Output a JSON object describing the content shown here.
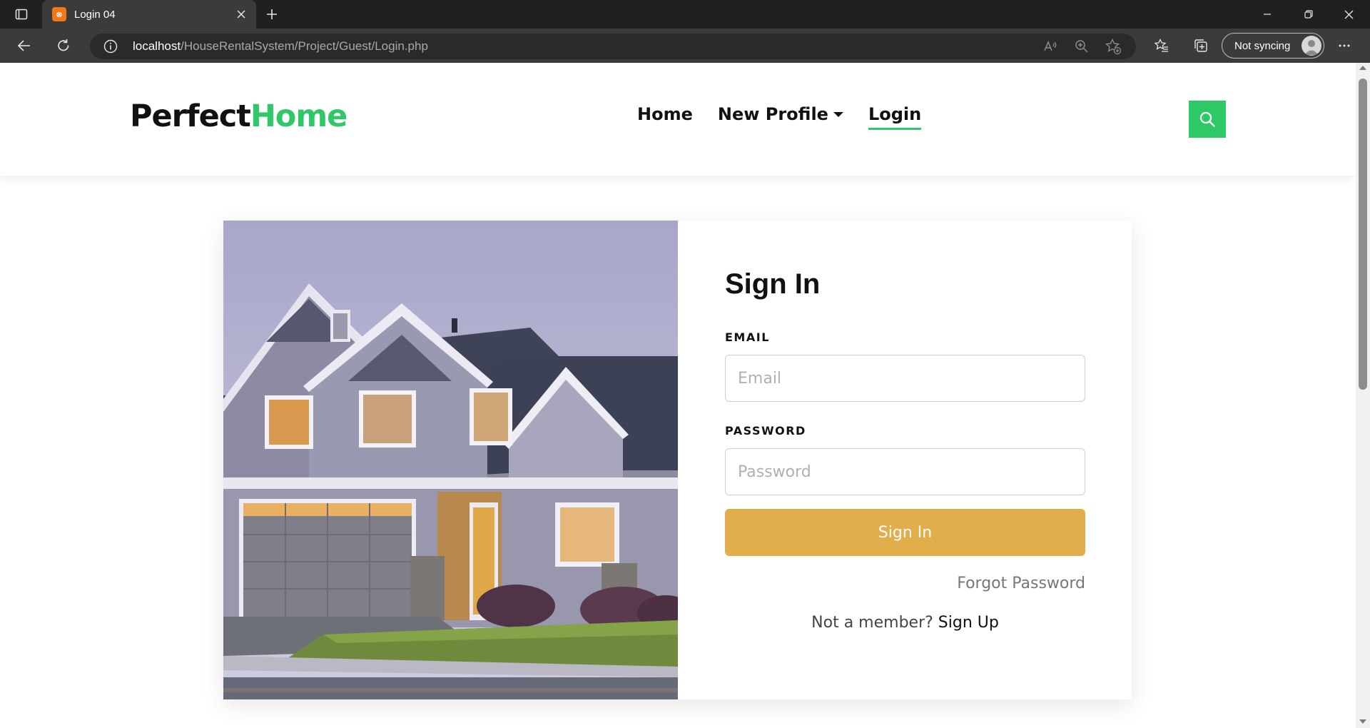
{
  "browser": {
    "tab_title": "Login 04",
    "favicon_text": "⊗",
    "url_host": "localhost",
    "url_path": "/HouseRentalSystem/Project/Guest/Login.php",
    "sync_label": "Not syncing"
  },
  "header": {
    "brand_part1": "Perfect",
    "brand_part2": "Home",
    "nav": [
      {
        "label": "Home"
      },
      {
        "label": "New Profile"
      },
      {
        "label": "Login"
      }
    ]
  },
  "signin": {
    "title": "Sign In",
    "email_label": "EMAIL",
    "email_placeholder": "Email",
    "password_label": "PASSWORD",
    "password_placeholder": "Password",
    "submit_label": "Sign In",
    "forgot_label": "Forgot Password",
    "member_text": "Not a member?",
    "signup_label": "Sign Up"
  },
  "colors": {
    "accent_green": "#2ec866",
    "button_gold": "#e2ae4b",
    "chrome_dark": "#202020"
  }
}
